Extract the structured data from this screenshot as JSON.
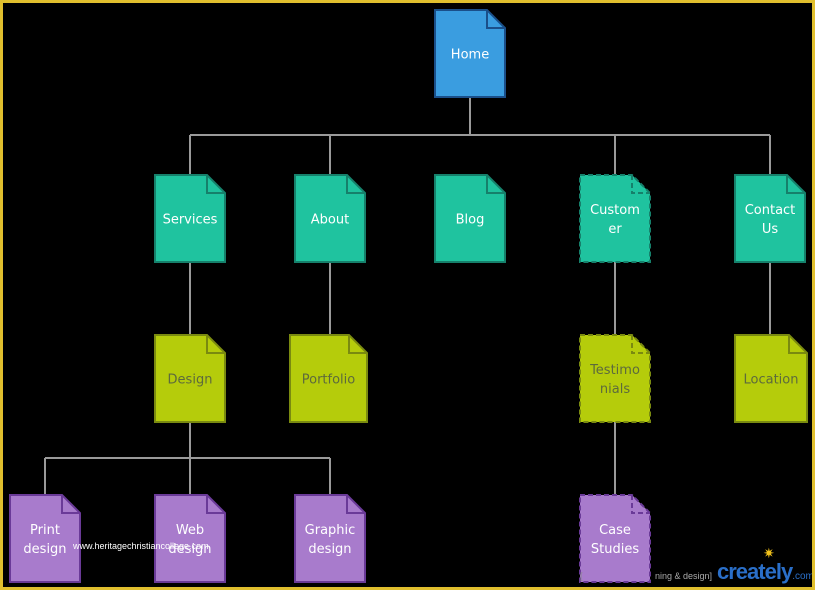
{
  "nodes": {
    "home": {
      "lines": [
        "Home"
      ]
    },
    "services": {
      "lines": [
        "Services"
      ]
    },
    "about": {
      "lines": [
        "About"
      ]
    },
    "blog": {
      "lines": [
        "Blog"
      ]
    },
    "customer": {
      "lines": [
        "Custom",
        "er"
      ]
    },
    "contact": {
      "lines": [
        "Contact",
        "Us"
      ]
    },
    "design": {
      "lines": [
        "Design"
      ]
    },
    "portfolio": {
      "lines": [
        "Portfolio"
      ]
    },
    "testimonials": {
      "lines": [
        "Testimo",
        "nials"
      ]
    },
    "location": {
      "lines": [
        "Location"
      ]
    },
    "print": {
      "lines": [
        "Print",
        "design"
      ]
    },
    "web": {
      "lines": [
        "Web",
        "design"
      ]
    },
    "graphic": {
      "lines": [
        "Graphic",
        "design"
      ]
    },
    "case": {
      "lines": [
        "Case",
        "Studies"
      ]
    }
  },
  "colors": {
    "frame": "#e0bf2e",
    "home": "#3a9de0",
    "level1": "#1fc39f",
    "level2": "#b5cc0b",
    "level3": "#a87bcc",
    "connector": "#9a9a9a"
  },
  "watermark": {
    "site": "www.heritagechristiancollege.com",
    "bracket_open": "[",
    "caption_fragment": "ning & design]",
    "logo": "creately",
    "logo_suffix": ".com"
  }
}
